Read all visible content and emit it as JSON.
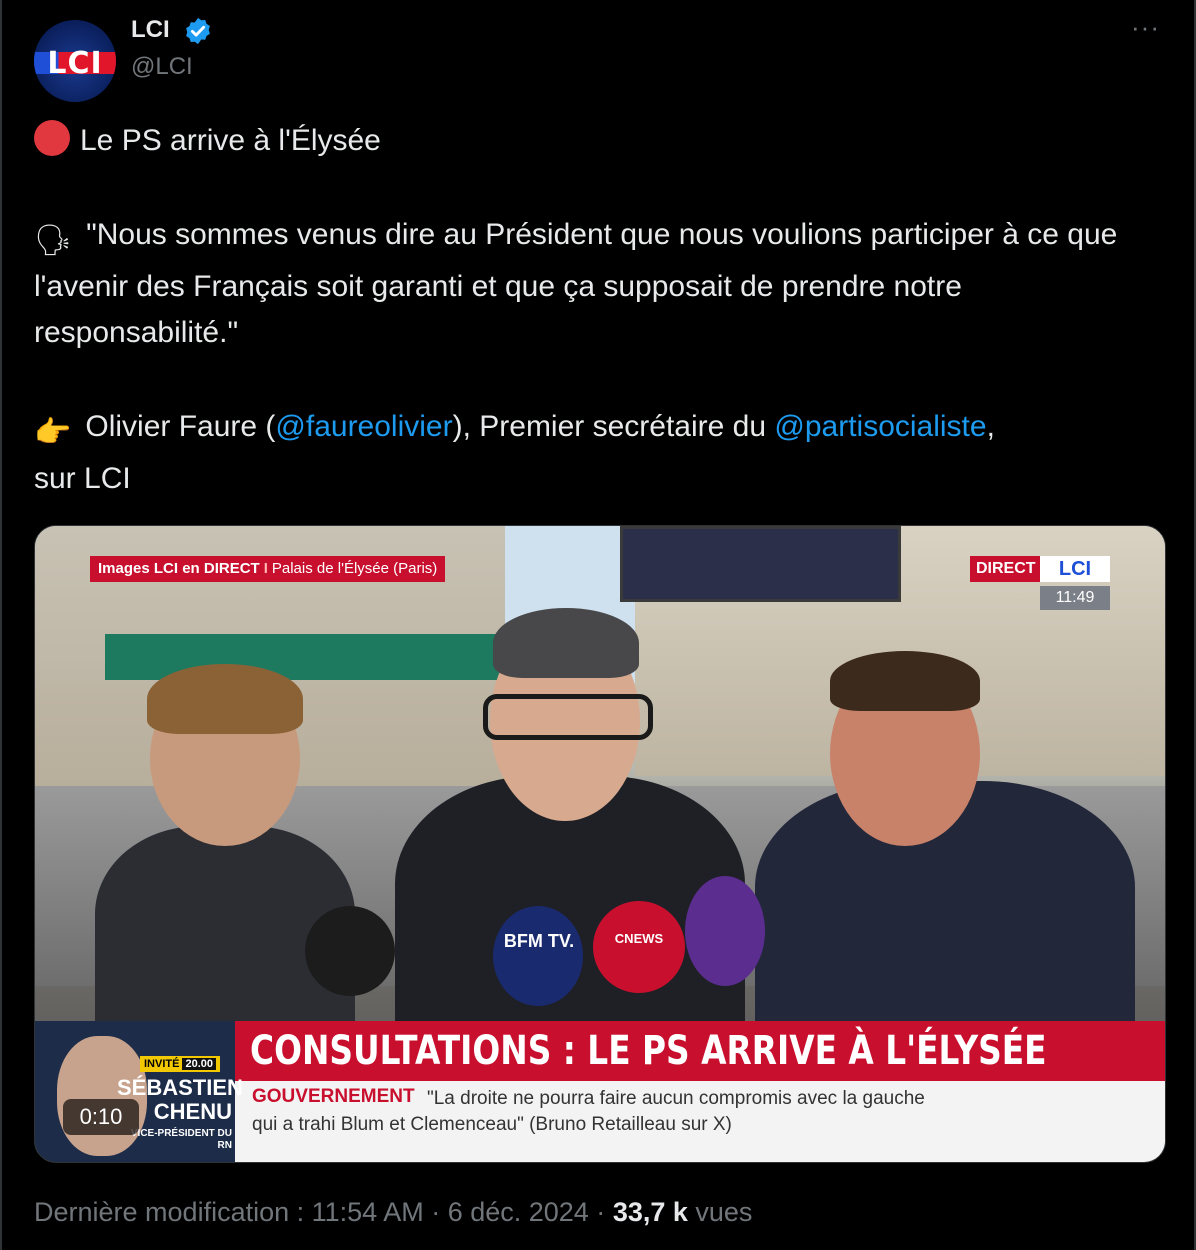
{
  "author": {
    "name": "LCI",
    "handle": "@LCI",
    "avatar_text": "LCI",
    "verified_icon": "verified-badge-icon",
    "more_label": "···"
  },
  "tweet": {
    "line1": "Le PS arrive à l'Élysée",
    "quote_emoji": "🗣",
    "quote": "\"Nous sommes venus dire au Président que nous voulions participer à ce que l'avenir des Français soit garanti et que ça supposait de prendre notre responsabilité.\"",
    "pointer_emoji": "👉",
    "attr_pre": "Olivier Faure (",
    "mention1": "@faureolivier",
    "attr_mid": "), Premier secrétaire du ",
    "mention2": "@partisocialiste",
    "attr_post": ",",
    "attr_line2": "sur LCI"
  },
  "video": {
    "live_label": "Images LCI en DIRECT",
    "separator": "I",
    "location": "Palais de l'Élysée (Paris)",
    "direct_label": "DIRECT",
    "channel_logo": "LCI",
    "clock": "11:49",
    "headline": "CONSULTATIONS : LE PS ARRIVE À L'ÉLYSÉE",
    "ticker_keyword": "GOUVERNEMENT",
    "ticker_text_line1": "\"La droite ne pourra faire aucun compromis avec la gauche",
    "ticker_text_line2": "qui a trahi Blum et Clemenceau\" (Bruno Retailleau sur X)",
    "guest_badge": "INVITÉ",
    "guest_time": "20.00",
    "guest_first": "SÉBASTIEN",
    "guest_last": "CHENU",
    "guest_role": "VICE-PRÉSIDENT DU RN",
    "mic_bfm": "BFM TV.",
    "mic_cnews": "CNEWS",
    "elapsed": "0:10"
  },
  "footer": {
    "modified": "Dernière modification : 11:54 AM · 6 déc. 2024 · ",
    "views_count": "33,7 k",
    "views_label": " vues"
  },
  "colors": {
    "background": "#000000",
    "text": "#e7e9ea",
    "muted": "#71767b",
    "link": "#1d9bf0",
    "lci_red": "#c8102e"
  }
}
